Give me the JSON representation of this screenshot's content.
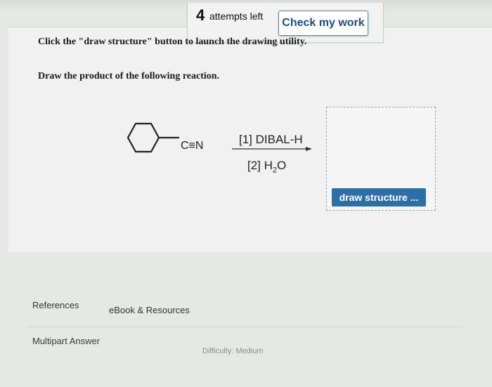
{
  "header": {
    "attempts_count": "4",
    "attempts_label": "attempts left",
    "check_button": "Check my work"
  },
  "question": {
    "instruction_1": "Click the \"draw structure\" button to launch the drawing utility.",
    "instruction_2": "Draw the product of the following reaction."
  },
  "reaction": {
    "substituent": "C≡N",
    "reagent_1": "[1] DIBAL-H",
    "reagent_2_prefix": "[2] H",
    "reagent_2_sub": "2",
    "reagent_2_suffix": "O"
  },
  "answer": {
    "draw_button": "draw structure ..."
  },
  "footer": {
    "references": "References",
    "ebook": "eBook & Resources",
    "multipart": "Multipart Answer",
    "difficulty": "Difficulty: Medium"
  }
}
